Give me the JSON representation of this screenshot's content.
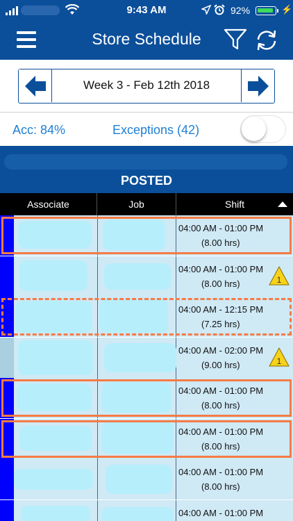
{
  "status_bar": {
    "time": "9:43 AM",
    "battery": "92%",
    "icons": [
      "signal-icon",
      "wifi-icon",
      "location-icon",
      "alarm-icon",
      "battery-icon",
      "charging-icon"
    ]
  },
  "navbar": {
    "title": "Store Schedule",
    "icons": [
      "menu-icon",
      "filter-icon",
      "refresh-icon"
    ]
  },
  "week": {
    "label": "Week 3 - Feb 12th 2018",
    "icons": [
      "prev-arrow-icon",
      "next-arrow-icon"
    ]
  },
  "summary": {
    "accuracy": "Acc: 84%",
    "exceptions": "Exceptions (42)",
    "toggle_on": false
  },
  "banner": {
    "label": "POSTED"
  },
  "table": {
    "headers": [
      "Associate",
      "Job",
      "Shift"
    ],
    "sort_icon": "sort-ascending-icon",
    "rows": [
      {
        "time": "04:00 AM - 01:00 PM",
        "hours": "(8.00 hrs)",
        "warning": "",
        "border": "solid"
      },
      {
        "time": "04:00 AM - 01:00 PM",
        "hours": "(8.00 hrs)",
        "warning": "1",
        "border": "none"
      },
      {
        "time": "04:00 AM - 12:15 PM",
        "hours": "(7.25 hrs)",
        "warning": "",
        "border": "dashed"
      },
      {
        "time": "04:00 AM - 02:00 PM",
        "hours": "(9.00 hrs)",
        "warning": "1",
        "border": "none"
      },
      {
        "time": "04:00 AM - 01:00 PM",
        "hours": "(8.00 hrs)",
        "warning": "",
        "border": "solid"
      },
      {
        "time": "04:00 AM - 01:00 PM",
        "hours": "(8.00 hrs)",
        "warning": "",
        "border": "solid"
      },
      {
        "time": "04:00 AM - 01:00 PM",
        "hours": "(8.00 hrs)",
        "warning": "",
        "border": "none"
      },
      {
        "time": "04:00 AM - 01:00 PM",
        "hours": "",
        "warning": "",
        "border": "none"
      }
    ]
  },
  "colors": {
    "brand_blue": "#0b4f9a",
    "link_blue": "#1e7fd6",
    "row_bg": "#cfe9f5",
    "status_blue": "#0000ff",
    "exception_border": "#f57b45",
    "warning_yellow": "#f7d21a"
  }
}
